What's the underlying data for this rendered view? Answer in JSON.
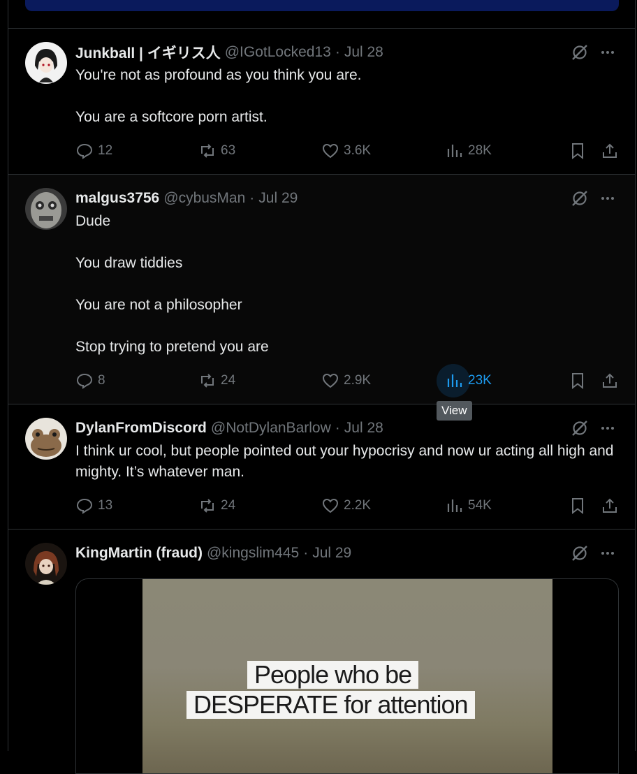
{
  "tweets": [
    {
      "name": "Junkball | イギリス人",
      "handle": "@IGotLocked13",
      "date": "Jul 28",
      "text": "You're not as profound as you think you are.\n\nYou are a softcore porn artist.",
      "replies": "12",
      "reposts": "63",
      "likes": "3.6K",
      "views": "28K"
    },
    {
      "name": "malgus3756",
      "handle": "@cybusMan",
      "date": "Jul 29",
      "text": "Dude\n\nYou draw tiddies\n\nYou are not a philosopher\n\nStop trying to pretend you are",
      "replies": "8",
      "reposts": "24",
      "likes": "2.9K",
      "views": "23K",
      "tooltip": "View"
    },
    {
      "name": "DylanFromDiscord",
      "handle": "@NotDylanBarlow",
      "date": "Jul 28",
      "text": "I think ur cool, but people pointed out your hypocrisy and now ur acting all high and mighty. It’s whatever man.",
      "replies": "13",
      "reposts": "24",
      "likes": "2.2K",
      "views": "54K"
    },
    {
      "name": "KingMartin (fraud)",
      "handle": "@kingslim445",
      "date": "Jul 29",
      "media_caption_line1": "People who be",
      "media_caption_line2": "DESPERATE for attention"
    }
  ],
  "separator": "·",
  "colors": {
    "accent": "#1d9bf0",
    "muted": "#71767b",
    "text": "#e7e9ea",
    "border": "#2f3336"
  },
  "icons": [
    "grok-icon",
    "more-icon",
    "reply-icon",
    "repost-icon",
    "like-icon",
    "views-icon",
    "bookmark-icon",
    "share-icon"
  ]
}
